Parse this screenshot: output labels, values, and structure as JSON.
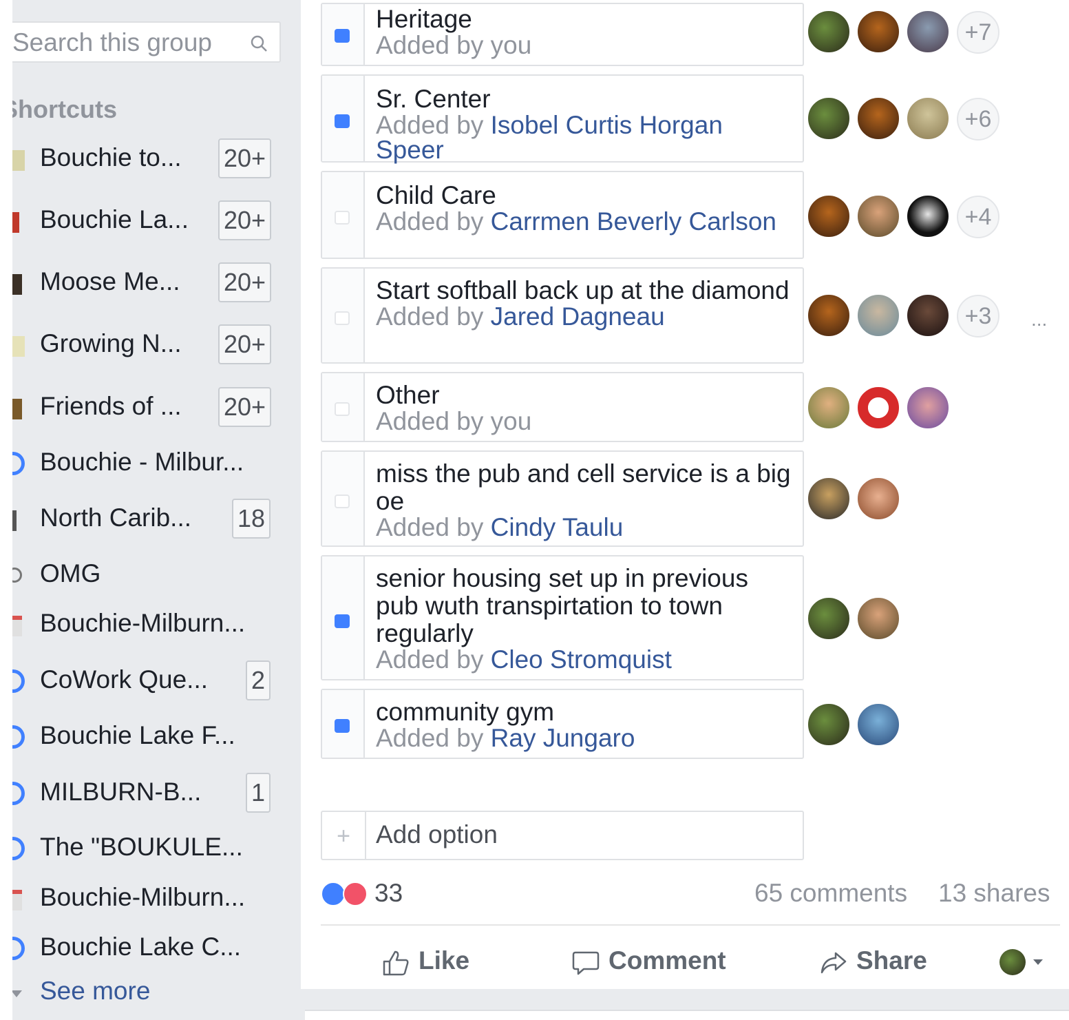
{
  "sidebar": {
    "search_placeholder": "Search this group",
    "shortcuts_title": "Shortcuts",
    "items": [
      {
        "label": "Bouchie to...",
        "badge": "20+",
        "icon_color": "#d8d4a8"
      },
      {
        "label": "Bouchie La...",
        "badge": "20+",
        "icon_color": "#c0392b"
      },
      {
        "label": "Moose Me...",
        "badge": "20+",
        "icon_color": "#3b3026"
      },
      {
        "label": "Growing N...",
        "badge": "20+",
        "icon_color": "#e6e2b8"
      },
      {
        "label": "Friends of ...",
        "badge": "20+",
        "icon_color": "#7a5a2a"
      },
      {
        "label": "Bouchie - Milbur...",
        "badge": "",
        "icon_color": "#4080ff"
      },
      {
        "label": "North Carib...",
        "badge": "18",
        "icon_color": "#555555"
      },
      {
        "label": "OMG",
        "badge": "",
        "icon_color": "#777777"
      },
      {
        "label": "Bouchie-Milburn...",
        "badge": "",
        "icon_color": "#d9534f"
      },
      {
        "label": "CoWork Que...",
        "badge": "2",
        "icon_color": "#4080ff"
      },
      {
        "label": "Bouchie Lake F...",
        "badge": "",
        "icon_color": "#4080ff"
      },
      {
        "label": "MILBURN-B...",
        "badge": "1",
        "icon_color": "#4080ff"
      },
      {
        "label": "The \"BOUKULE...",
        "badge": "",
        "icon_color": "#4080ff"
      },
      {
        "label": "Bouchie-Milburn...",
        "badge": "",
        "icon_color": "#d9534f"
      },
      {
        "label": "Bouchie Lake C...",
        "badge": "",
        "icon_color": "#4080ff"
      }
    ],
    "see_more": "See more"
  },
  "poll": {
    "options": [
      {
        "title": "Heritage",
        "added_prefix": "Added by you",
        "added_by": "",
        "checked": true,
        "more": "+7"
      },
      {
        "title": "Sr. Center",
        "added_prefix": "Added by ",
        "added_by": "Isobel Curtis Horgan Speer",
        "checked": true,
        "more": "+6"
      },
      {
        "title": "Child Care",
        "added_prefix": "Added by ",
        "added_by": "Carrmen Beverly Carlson",
        "checked": false,
        "more": "+4"
      },
      {
        "title": "Start softball back up at the diamond",
        "added_prefix": "Added by ",
        "added_by": "Jared Dagneau",
        "checked": false,
        "more": "+3"
      },
      {
        "title": "Other",
        "added_prefix": "Added by you",
        "added_by": "",
        "checked": false,
        "more": ""
      },
      {
        "title": "miss the pub and cell service is a big oe",
        "added_prefix": "Added by ",
        "added_by": "Cindy Taulu",
        "checked": false,
        "more": ""
      },
      {
        "title": "senior housing set up in previous pub wuth transpirtation to town regularly",
        "added_prefix": "Added by ",
        "added_by": "Cleo Stromquist",
        "checked": true,
        "more": ""
      },
      {
        "title": "community gym",
        "added_prefix": "Added by ",
        "added_by": "Ray Jungaro",
        "checked": true,
        "more": ""
      }
    ],
    "add_option": "Add option",
    "option_menu": "..."
  },
  "footer": {
    "reaction_count": "33",
    "comments": "65 comments",
    "shares": "13 shares",
    "like": "Like",
    "comment": "Comment",
    "share": "Share"
  },
  "colors": {
    "link": "#365899",
    "checkbox_on": "#4080ff",
    "sidebar_bg": "#e9ebee"
  }
}
